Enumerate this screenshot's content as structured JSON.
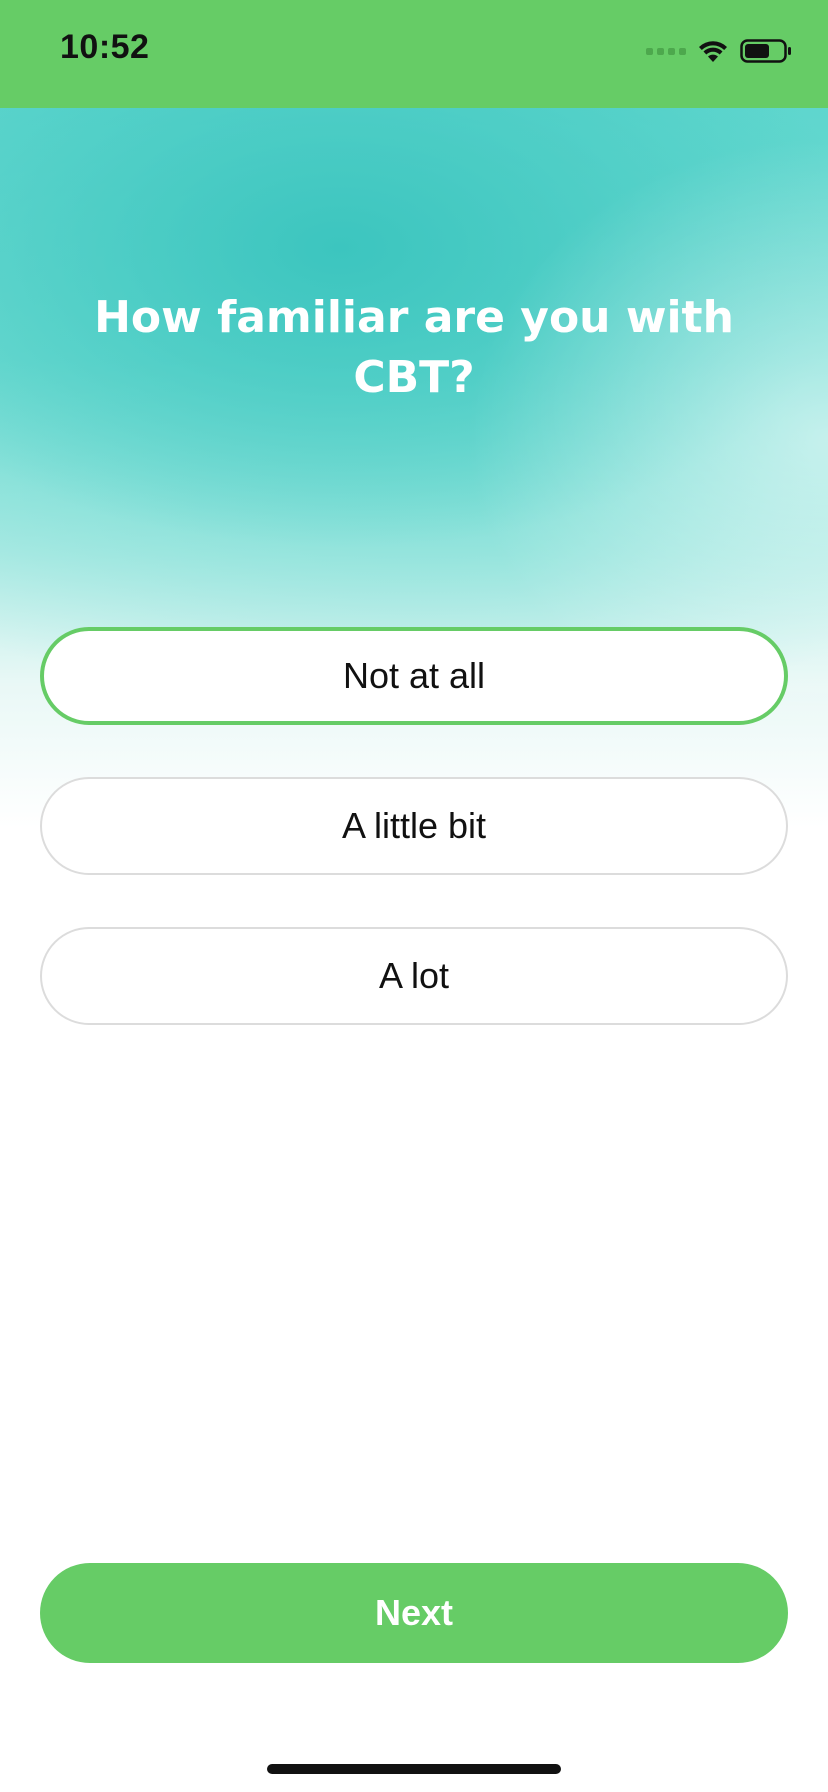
{
  "status_bar": {
    "time": "10:52",
    "icons": [
      "cellular-signal-icon",
      "wifi-icon",
      "battery-icon"
    ],
    "background": "#66cc66"
  },
  "question": {
    "title": "How familiar are you with CBT?"
  },
  "options": [
    {
      "label": "Not at all",
      "selected": true
    },
    {
      "label": "A little bit",
      "selected": false
    },
    {
      "label": "A lot",
      "selected": false
    }
  ],
  "actions": {
    "next_label": "Next"
  },
  "colors": {
    "accent": "#66cc66",
    "gradient_teal": "#5fd6ce",
    "option_border": "#dcdcdc"
  }
}
